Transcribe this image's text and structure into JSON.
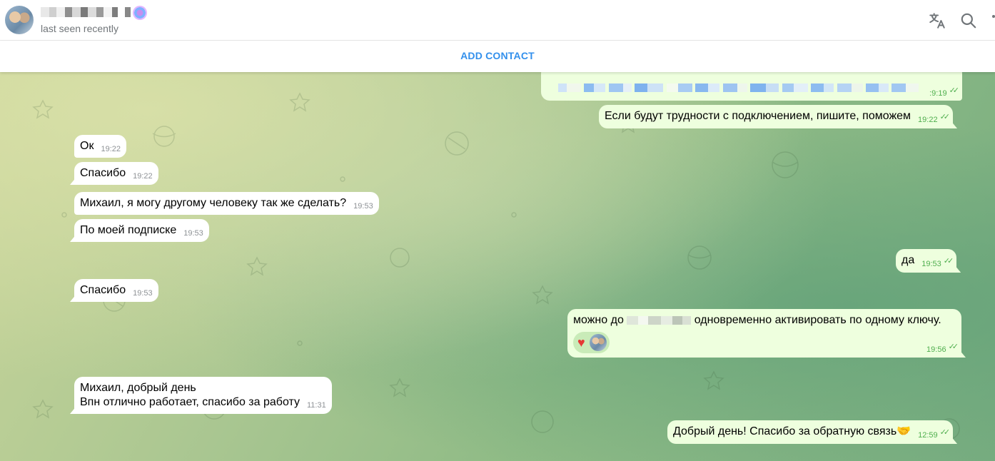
{
  "header": {
    "status": "last seen recently",
    "icons": [
      "translate-icon",
      "search-icon",
      "more-icon"
    ]
  },
  "add_contact": {
    "label": "ADD CONTACT"
  },
  "colors": {
    "accent": "#3390ec",
    "incoming": "#ffffff",
    "outgoing": "#eeffde",
    "check": "#4fae4e"
  },
  "messages": [
    {
      "side": "out",
      "text": "",
      "time": ":9:19",
      "partial": true
    },
    {
      "side": "out",
      "text": "Если будут трудности с подключением, пишите, поможем",
      "time": "19:22"
    },
    {
      "side": "in",
      "text": "Ок",
      "time": "19:22"
    },
    {
      "side": "in",
      "text": "Спасибо",
      "time": "19:22"
    },
    {
      "side": "in",
      "text": "Михаил, я могу другому человеку так же сделать?",
      "time": "19:53"
    },
    {
      "side": "in",
      "text": "По моей подписке",
      "time": "19:53"
    },
    {
      "side": "out",
      "text": "да",
      "time": "19:53"
    },
    {
      "side": "in",
      "text": "Спасибо",
      "time": "19:53"
    },
    {
      "side": "out",
      "text_before": "можно до",
      "text_after": "одновременно активировать по одному ключу.",
      "time": "19:56",
      "reaction": "heart"
    },
    {
      "side": "in",
      "lines": [
        "Михаил, добрый день",
        "Впн отлично работает, спасибо за работу"
      ],
      "time": "11:31"
    },
    {
      "side": "out",
      "text": "Добрый день! Спасибо за обратную связь🤝",
      "time": "12:59"
    }
  ]
}
